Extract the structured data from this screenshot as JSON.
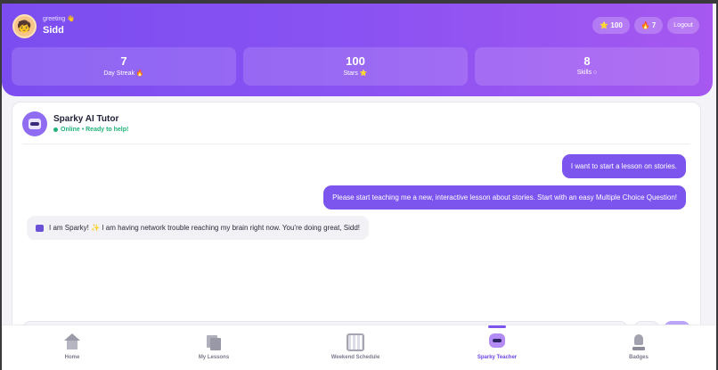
{
  "header": {
    "greeting": "greeting 👋",
    "username": "Sidd",
    "avatar_emoji": "🧒",
    "stars_pill": "⭐ 100",
    "streak_pill": "🔥 7",
    "logout_label": "Logout"
  },
  "stats": [
    {
      "value": "7",
      "label": "Day Streak 🔥"
    },
    {
      "value": "100",
      "label": "Stars ⭐"
    },
    {
      "value": "8",
      "label": "Skills ○"
    }
  ],
  "chat": {
    "tutor_name": "Sparky AI Tutor",
    "status": "Online • Ready to help!",
    "messages": [
      {
        "from": "user",
        "text": "I want to start a lesson on stories."
      },
      {
        "from": "user",
        "text": "Please start teaching me a new, interactive lesson about stories. Start with an easy Multiple Choice Question!"
      },
      {
        "from": "bot",
        "text": "I am Sparky! ✨ I am having network trouble reaching my brain right now. You're doing great, Sidd!"
      }
    ]
  },
  "nav": {
    "items": [
      {
        "label": "Home",
        "icon": "home-icon"
      },
      {
        "label": "My Lessons",
        "icon": "lessons-icon"
      },
      {
        "label": "Weekend Schedule",
        "icon": "calendar-icon"
      },
      {
        "label": "Sparky Teacher",
        "icon": "robot-icon",
        "active": true
      },
      {
        "label": "Badges",
        "icon": "trophy-icon"
      }
    ]
  },
  "colors": {
    "accent": "#7c55ee",
    "header_start": "#7b4df0",
    "header_end": "#a658f0",
    "online": "#20b27a"
  }
}
